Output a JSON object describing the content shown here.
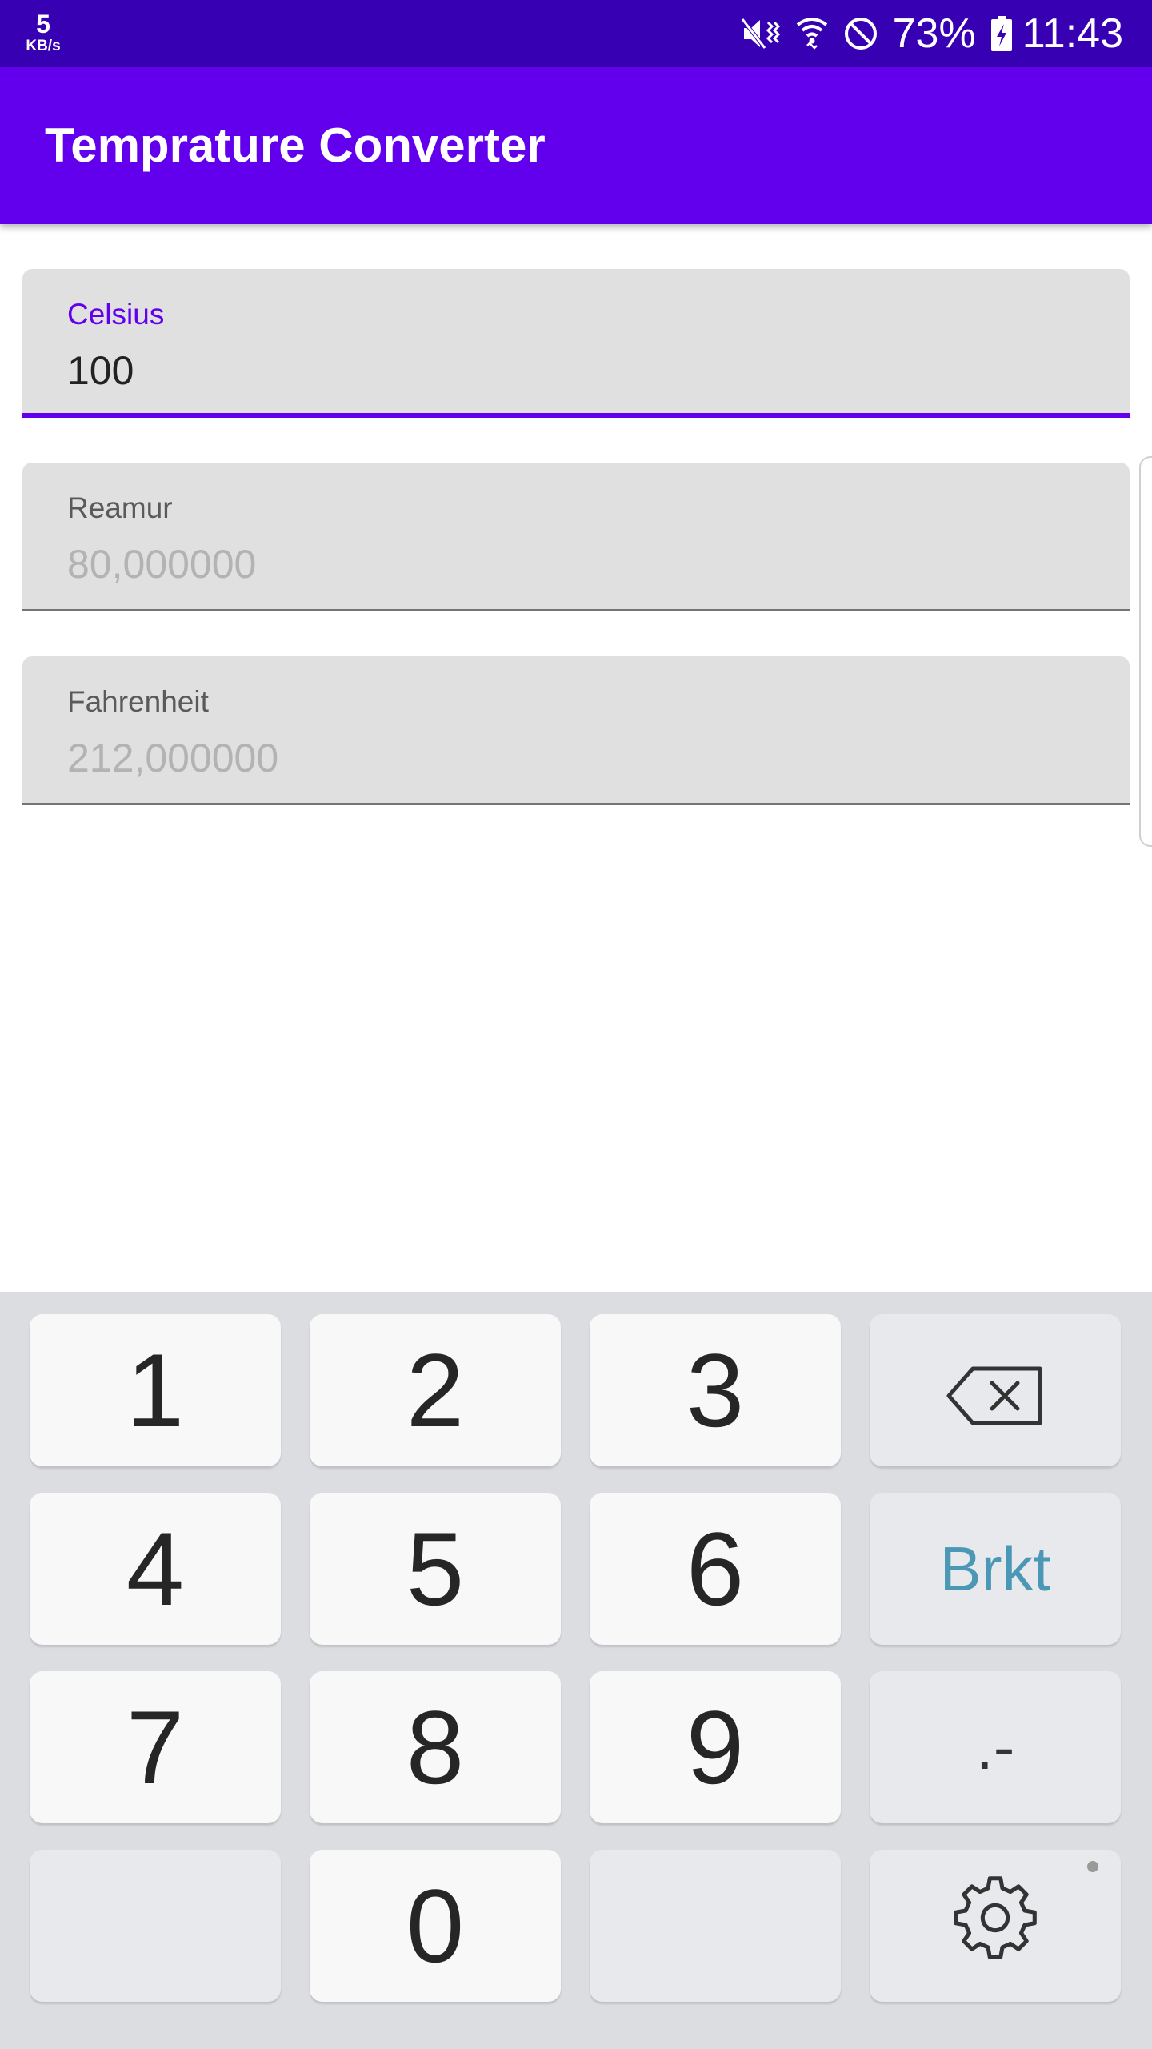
{
  "status_bar": {
    "net_speed_value": "5",
    "net_speed_unit": "KB/s",
    "battery_percent": "73%",
    "time": "11:43",
    "icons": [
      "mute-vibrate-icon",
      "wifi-icon",
      "do-not-disturb-icon",
      "battery-charging-icon"
    ]
  },
  "app_bar": {
    "title": "Temprature Converter"
  },
  "fields": {
    "celsius": {
      "label": "Celsius",
      "value": "100"
    },
    "reamur": {
      "label": "Reamur",
      "value": "80,000000"
    },
    "fahrenheit": {
      "label": "Fahrenheit",
      "value": "212,000000"
    }
  },
  "keyboard": {
    "keys": [
      "1",
      "2",
      "3",
      "4",
      "5",
      "6",
      "7",
      "8",
      "9",
      "0"
    ],
    "bracket_label": "Brkt",
    "dot_minus_label": ".-",
    "special_icons": [
      "backspace-icon",
      "gear-icon"
    ]
  },
  "colors": {
    "status_bar": "#3700b3",
    "app_bar": "#6200ee",
    "accent": "#6200ee",
    "keyboard_bg": "#dcdde1",
    "brkt_text": "#4a98b6"
  }
}
